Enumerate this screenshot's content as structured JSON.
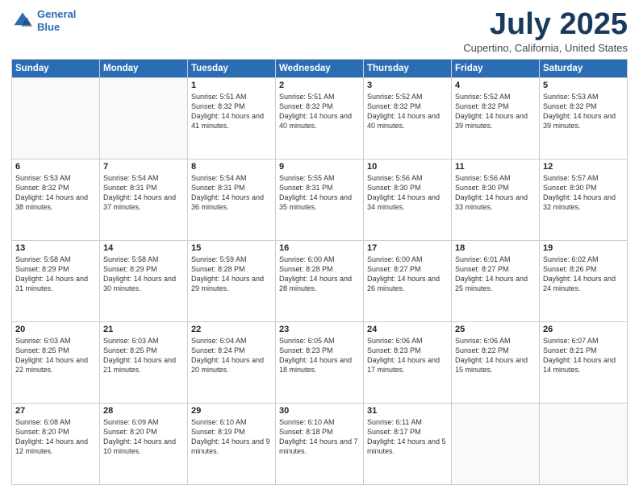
{
  "logo": {
    "line1": "General",
    "line2": "Blue"
  },
  "title": "July 2025",
  "subtitle": "Cupertino, California, United States",
  "weekdays": [
    "Sunday",
    "Monday",
    "Tuesday",
    "Wednesday",
    "Thursday",
    "Friday",
    "Saturday"
  ],
  "weeks": [
    [
      {
        "day": "",
        "info": ""
      },
      {
        "day": "",
        "info": ""
      },
      {
        "day": "1",
        "info": "Sunrise: 5:51 AM\nSunset: 8:32 PM\nDaylight: 14 hours and 41 minutes."
      },
      {
        "day": "2",
        "info": "Sunrise: 5:51 AM\nSunset: 8:32 PM\nDaylight: 14 hours and 40 minutes."
      },
      {
        "day": "3",
        "info": "Sunrise: 5:52 AM\nSunset: 8:32 PM\nDaylight: 14 hours and 40 minutes."
      },
      {
        "day": "4",
        "info": "Sunrise: 5:52 AM\nSunset: 8:32 PM\nDaylight: 14 hours and 39 minutes."
      },
      {
        "day": "5",
        "info": "Sunrise: 5:53 AM\nSunset: 8:32 PM\nDaylight: 14 hours and 39 minutes."
      }
    ],
    [
      {
        "day": "6",
        "info": "Sunrise: 5:53 AM\nSunset: 8:32 PM\nDaylight: 14 hours and 38 minutes."
      },
      {
        "day": "7",
        "info": "Sunrise: 5:54 AM\nSunset: 8:31 PM\nDaylight: 14 hours and 37 minutes."
      },
      {
        "day": "8",
        "info": "Sunrise: 5:54 AM\nSunset: 8:31 PM\nDaylight: 14 hours and 36 minutes."
      },
      {
        "day": "9",
        "info": "Sunrise: 5:55 AM\nSunset: 8:31 PM\nDaylight: 14 hours and 35 minutes."
      },
      {
        "day": "10",
        "info": "Sunrise: 5:56 AM\nSunset: 8:30 PM\nDaylight: 14 hours and 34 minutes."
      },
      {
        "day": "11",
        "info": "Sunrise: 5:56 AM\nSunset: 8:30 PM\nDaylight: 14 hours and 33 minutes."
      },
      {
        "day": "12",
        "info": "Sunrise: 5:57 AM\nSunset: 8:30 PM\nDaylight: 14 hours and 32 minutes."
      }
    ],
    [
      {
        "day": "13",
        "info": "Sunrise: 5:58 AM\nSunset: 8:29 PM\nDaylight: 14 hours and 31 minutes."
      },
      {
        "day": "14",
        "info": "Sunrise: 5:58 AM\nSunset: 8:29 PM\nDaylight: 14 hours and 30 minutes."
      },
      {
        "day": "15",
        "info": "Sunrise: 5:59 AM\nSunset: 8:28 PM\nDaylight: 14 hours and 29 minutes."
      },
      {
        "day": "16",
        "info": "Sunrise: 6:00 AM\nSunset: 8:28 PM\nDaylight: 14 hours and 28 minutes."
      },
      {
        "day": "17",
        "info": "Sunrise: 6:00 AM\nSunset: 8:27 PM\nDaylight: 14 hours and 26 minutes."
      },
      {
        "day": "18",
        "info": "Sunrise: 6:01 AM\nSunset: 8:27 PM\nDaylight: 14 hours and 25 minutes."
      },
      {
        "day": "19",
        "info": "Sunrise: 6:02 AM\nSunset: 8:26 PM\nDaylight: 14 hours and 24 minutes."
      }
    ],
    [
      {
        "day": "20",
        "info": "Sunrise: 6:03 AM\nSunset: 8:25 PM\nDaylight: 14 hours and 22 minutes."
      },
      {
        "day": "21",
        "info": "Sunrise: 6:03 AM\nSunset: 8:25 PM\nDaylight: 14 hours and 21 minutes."
      },
      {
        "day": "22",
        "info": "Sunrise: 6:04 AM\nSunset: 8:24 PM\nDaylight: 14 hours and 20 minutes."
      },
      {
        "day": "23",
        "info": "Sunrise: 6:05 AM\nSunset: 8:23 PM\nDaylight: 14 hours and 18 minutes."
      },
      {
        "day": "24",
        "info": "Sunrise: 6:06 AM\nSunset: 8:23 PM\nDaylight: 14 hours and 17 minutes."
      },
      {
        "day": "25",
        "info": "Sunrise: 6:06 AM\nSunset: 8:22 PM\nDaylight: 14 hours and 15 minutes."
      },
      {
        "day": "26",
        "info": "Sunrise: 6:07 AM\nSunset: 8:21 PM\nDaylight: 14 hours and 14 minutes."
      }
    ],
    [
      {
        "day": "27",
        "info": "Sunrise: 6:08 AM\nSunset: 8:20 PM\nDaylight: 14 hours and 12 minutes."
      },
      {
        "day": "28",
        "info": "Sunrise: 6:09 AM\nSunset: 8:20 PM\nDaylight: 14 hours and 10 minutes."
      },
      {
        "day": "29",
        "info": "Sunrise: 6:10 AM\nSunset: 8:19 PM\nDaylight: 14 hours and 9 minutes."
      },
      {
        "day": "30",
        "info": "Sunrise: 6:10 AM\nSunset: 8:18 PM\nDaylight: 14 hours and 7 minutes."
      },
      {
        "day": "31",
        "info": "Sunrise: 6:11 AM\nSunset: 8:17 PM\nDaylight: 14 hours and 5 minutes."
      },
      {
        "day": "",
        "info": ""
      },
      {
        "day": "",
        "info": ""
      }
    ]
  ]
}
